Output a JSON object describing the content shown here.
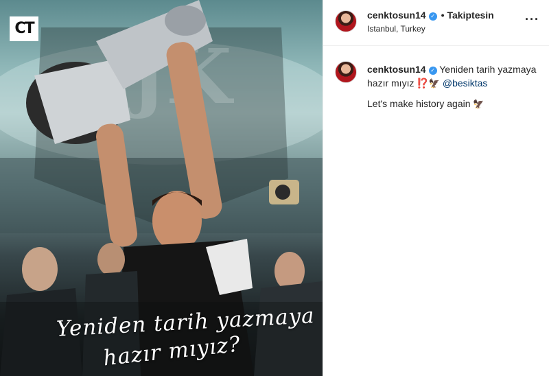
{
  "post": {
    "logo_text": "CT",
    "caption_line_1": "Yeniden tarih yazmaya",
    "caption_line_2": "hazır mıyız?"
  },
  "header": {
    "username": "cenktosun14",
    "verified_mark": "✓",
    "separator": "•",
    "follow_label": "Takiptesin",
    "location": "Istanbul, Turkey",
    "more_label": "···"
  },
  "comment": {
    "username": "cenktosun14",
    "verified_mark": "✓",
    "text_part": "Yeniden tarih yazmaya hazır mıyız ⁉️",
    "emoji_eagle": "🦅",
    "mention": "@besiktas",
    "second_line": "Let's make history again",
    "emoji_eagle_2": "🦅"
  },
  "colors": {
    "verified": "#3897f0",
    "mention": "#00376b",
    "text": "#262626",
    "divider": "#efefef"
  },
  "icons": [
    "verified-badge-icon",
    "more-options-icon",
    "eagle-emoji-icon"
  ]
}
